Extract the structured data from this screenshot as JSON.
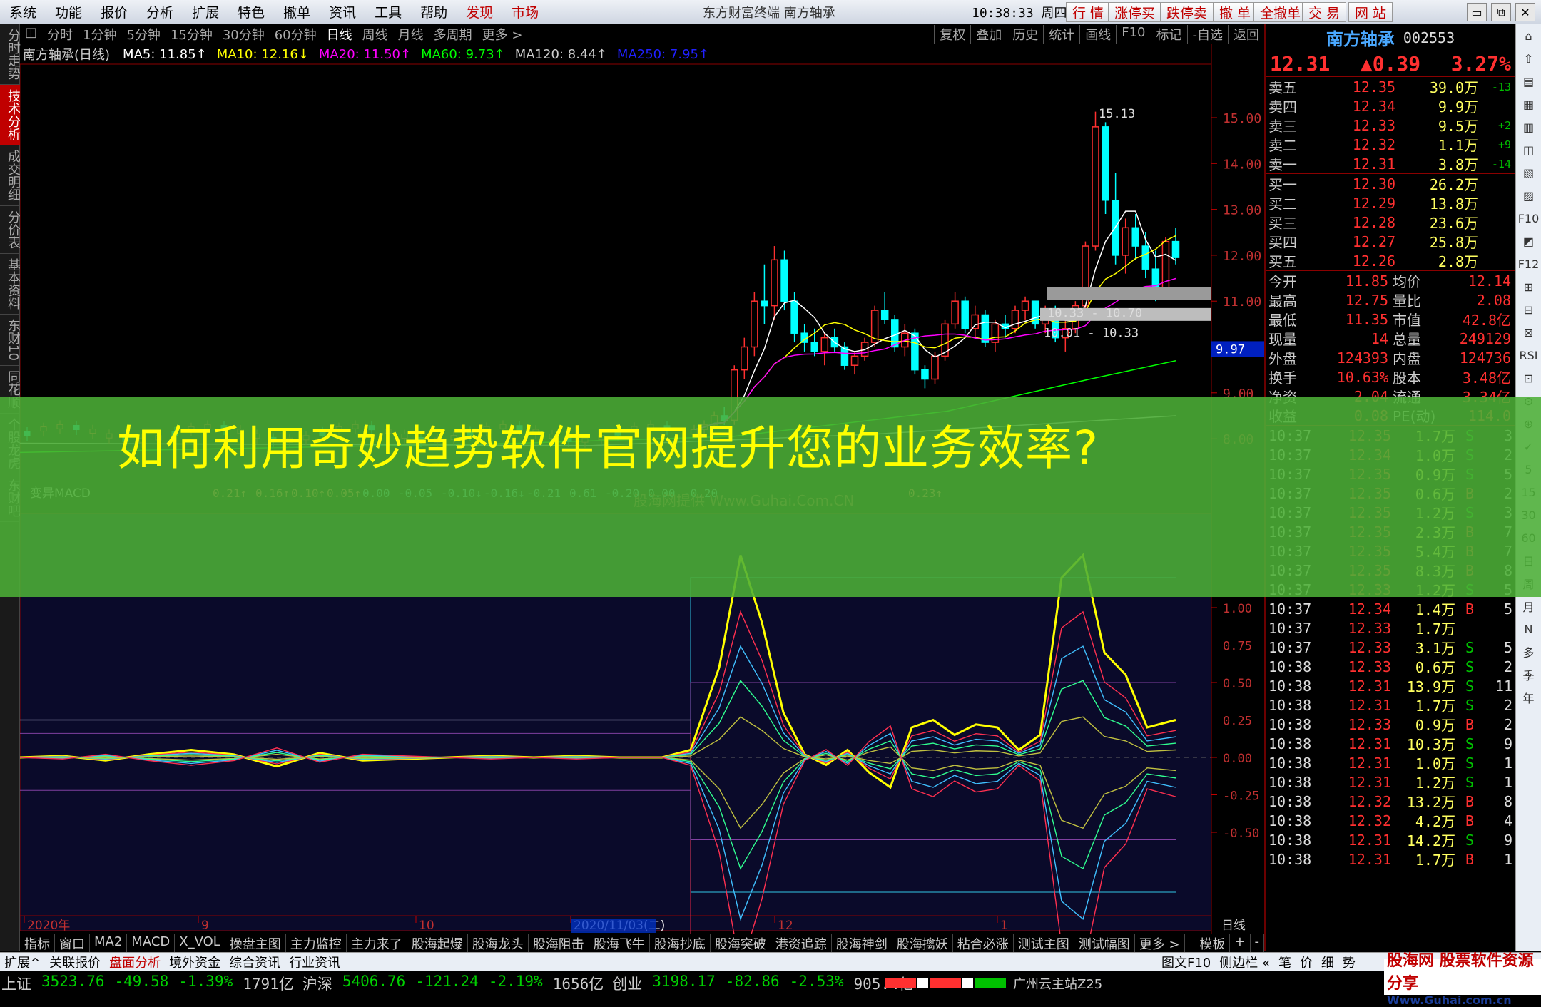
{
  "menubar": {
    "items": [
      "系统",
      "功能",
      "报价",
      "分析",
      "扩展",
      "特色",
      "撤单",
      "资讯",
      "工具",
      "帮助"
    ],
    "highlight_items": [
      "发现",
      "市场"
    ],
    "center_text": "东方财富终端  南方轴承",
    "clock": "10:38:33 周四",
    "right_buttons": [
      "行 情",
      "涨停买",
      "跌停卖",
      "撤 单",
      "全撤单",
      "交 易",
      "网 站"
    ],
    "window_buttons": [
      "▭",
      "⧉",
      "✕"
    ]
  },
  "left_tabs": [
    "分时走势",
    "技术分析",
    "成交明细",
    "分价表",
    "基本资料",
    "东财10",
    "同花顺",
    "个股龙虎",
    "东财吧"
  ],
  "toolbar": {
    "periods": [
      "分时",
      "1分钟",
      "5分钟",
      "15分钟",
      "30分钟",
      "60分钟",
      "日线",
      "周线",
      "月线",
      "多周期",
      "更多 >"
    ],
    "active_period": "日线",
    "right_tools": [
      "复权",
      "叠加",
      "历史",
      "统计",
      "画线",
      "F10",
      "标记",
      "-自选",
      "返回"
    ]
  },
  "infobar": {
    "title": "南方轴承(日线)",
    "ma": [
      {
        "label": "MA5: 11.85↑",
        "color": "#ffffff"
      },
      {
        "label": "MA10: 12.16↓",
        "color": "#ffff00"
      },
      {
        "label": "MA20: 11.50↑",
        "color": "#ff00ff"
      },
      {
        "label": "MA60: 9.73↑",
        "color": "#00ff00"
      },
      {
        "label": "MA120: 8.44↑",
        "color": "#cccccc"
      },
      {
        "label": "MA250: 7.95↑",
        "color": "#2020ff"
      }
    ]
  },
  "chart_data": [
    {
      "type": "candlestick",
      "title": "南方轴承(日线)",
      "y_ticks": [
        "15.00",
        "14.00",
        "13.00",
        "12.00",
        "11.00",
        "10.00",
        "9.00",
        "8.00"
      ],
      "price_tag": "9.97",
      "annotations": [
        "15.13",
        "10.33 - 10.70",
        "10.01 - 10.33"
      ],
      "x_labels": [
        "2020年",
        "9",
        "10",
        "2020/11/03(二)",
        "12",
        "1"
      ],
      "candles": [
        [
          8.1,
          8.3,
          8.0,
          8.2
        ],
        [
          8.2,
          8.4,
          8.1,
          8.3
        ],
        [
          8.3,
          8.6,
          8.2,
          8.5
        ],
        [
          8.5,
          8.7,
          8.3,
          8.4
        ],
        [
          8.4,
          9.6,
          8.3,
          9.5
        ],
        [
          9.5,
          10.2,
          9.3,
          10.0
        ],
        [
          10.0,
          11.2,
          9.8,
          11.0
        ],
        [
          11.0,
          11.8,
          10.5,
          10.9
        ],
        [
          10.9,
          12.2,
          10.6,
          11.9
        ],
        [
          11.9,
          12.1,
          10.8,
          11.0
        ],
        [
          11.0,
          11.2,
          10.1,
          10.3
        ],
        [
          10.3,
          10.5,
          9.9,
          10.1
        ],
        [
          10.1,
          10.4,
          9.8,
          9.9
        ],
        [
          9.9,
          10.3,
          9.6,
          10.2
        ],
        [
          10.2,
          10.4,
          9.9,
          10.0
        ],
        [
          10.0,
          10.1,
          9.5,
          9.6
        ],
        [
          9.6,
          9.9,
          9.4,
          9.8
        ],
        [
          9.8,
          10.2,
          9.7,
          10.1
        ],
        [
          10.1,
          10.9,
          10.0,
          10.8
        ],
        [
          10.8,
          11.2,
          10.5,
          10.6
        ],
        [
          10.6,
          10.7,
          9.9,
          10.0
        ],
        [
          10.0,
          10.5,
          9.8,
          10.3
        ],
        [
          10.3,
          10.4,
          9.4,
          9.5
        ],
        [
          9.5,
          9.6,
          9.1,
          9.3
        ],
        [
          9.3,
          9.9,
          9.2,
          9.8
        ],
        [
          9.8,
          10.6,
          9.7,
          10.5
        ],
        [
          10.5,
          11.2,
          10.4,
          11.0
        ],
        [
          11.0,
          11.1,
          10.3,
          10.4
        ],
        [
          10.4,
          10.9,
          10.2,
          10.7
        ],
        [
          10.7,
          10.8,
          10.0,
          10.1
        ],
        [
          10.1,
          10.6,
          9.9,
          10.5
        ],
        [
          10.5,
          10.7,
          10.2,
          10.4
        ],
        [
          10.4,
          10.9,
          10.3,
          10.8
        ],
        [
          10.8,
          11.1,
          10.6,
          11.0
        ],
        [
          11.0,
          11.0,
          10.4,
          10.5
        ],
        [
          10.5,
          10.9,
          10.3,
          10.8
        ],
        [
          10.8,
          10.9,
          10.1,
          10.2
        ],
        [
          10.2,
          10.6,
          9.9,
          10.4
        ],
        [
          10.4,
          11.0,
          10.3,
          10.9
        ],
        [
          10.9,
          12.3,
          10.8,
          12.2
        ],
        [
          12.2,
          15.13,
          12.1,
          14.8
        ],
        [
          14.8,
          14.9,
          12.9,
          13.2
        ],
        [
          13.2,
          13.8,
          11.8,
          12.0
        ],
        [
          12.0,
          12.8,
          11.6,
          12.6
        ],
        [
          12.6,
          12.9,
          11.9,
          12.2
        ],
        [
          12.2,
          12.5,
          11.5,
          11.7
        ],
        [
          11.7,
          12.1,
          11.0,
          11.3
        ],
        [
          11.3,
          12.4,
          11.1,
          12.3
        ],
        [
          12.3,
          12.6,
          11.8,
          11.95
        ]
      ]
    },
    {
      "type": "line",
      "title": "变异MACD",
      "values_text": [
        "0.21↑",
        "0.16↑",
        "0.10↑",
        "0.05↑",
        "0.00",
        "-0.05",
        "-0.10↓",
        "-0.16↓",
        "-0.21",
        "0.61",
        "-0.20",
        "0.00",
        "-0.20"
      ],
      "last_text": "0.23↑",
      "y_ticks": [
        "1.00",
        "0.75",
        "0.50",
        "0.25",
        "0.00",
        "-0.25",
        "-0.50"
      ],
      "watermark": "股海网提供 Www.Guhai.Com.CN"
    }
  ],
  "quote": {
    "name": "南方轴承",
    "code": "002553",
    "price": "12.31",
    "change": "▲0.39",
    "pct": "3.27%",
    "asks": [
      {
        "lbl": "卖五",
        "pr": "12.35",
        "vol": "39.0万",
        "chg": "-13"
      },
      {
        "lbl": "卖四",
        "pr": "12.34",
        "vol": "9.9万",
        "chg": ""
      },
      {
        "lbl": "卖三",
        "pr": "12.33",
        "vol": "9.5万",
        "chg": "+2"
      },
      {
        "lbl": "卖二",
        "pr": "12.32",
        "vol": "1.1万",
        "chg": "+9"
      },
      {
        "lbl": "卖一",
        "pr": "12.31",
        "vol": "3.8万",
        "chg": "-14"
      }
    ],
    "bids": [
      {
        "lbl": "买一",
        "pr": "12.30",
        "vol": "26.2万",
        "chg": ""
      },
      {
        "lbl": "买二",
        "pr": "12.29",
        "vol": "13.8万",
        "chg": ""
      },
      {
        "lbl": "买三",
        "pr": "12.28",
        "vol": "23.6万",
        "chg": ""
      },
      {
        "lbl": "买四",
        "pr": "12.27",
        "vol": "25.8万",
        "chg": ""
      },
      {
        "lbl": "买五",
        "pr": "12.26",
        "vol": "2.8万",
        "chg": ""
      }
    ],
    "stats": [
      [
        "今开",
        "11.85",
        "均价",
        "12.14"
      ],
      [
        "最高",
        "12.75",
        "量比",
        "2.08"
      ],
      [
        "最低",
        "11.35",
        "市值",
        "42.8亿"
      ],
      [
        "现量",
        "14",
        "总量",
        "249129"
      ],
      [
        "外盘",
        "124393",
        "内盘",
        "124736"
      ],
      [
        "换手",
        "10.63%",
        "股本",
        "3.48亿"
      ],
      [
        "净资",
        "2.04",
        "流通",
        "3.34亿"
      ],
      [
        "收益",
        "0.08",
        "PE(动)",
        "114.0"
      ]
    ],
    "trades": [
      [
        "10:37",
        "12.35",
        "1.7万",
        "S",
        "3"
      ],
      [
        "10:37",
        "12.34",
        "1.0万",
        "S",
        "2"
      ],
      [
        "10:37",
        "12.35",
        "0.9万",
        "S",
        "5"
      ],
      [
        "10:37",
        "12.35",
        "0.6万",
        "B",
        "2"
      ],
      [
        "10:37",
        "12.35",
        "1.2万",
        "S",
        "3"
      ],
      [
        "10:37",
        "12.35",
        "2.3万",
        "B",
        "7"
      ],
      [
        "10:37",
        "12.35",
        "5.4万",
        "B",
        "7"
      ],
      [
        "10:37",
        "12.35",
        "8.3万",
        "B",
        "8"
      ],
      [
        "10:37",
        "12.33",
        "1.2万",
        "S",
        "5"
      ],
      [
        "10:37",
        "12.34",
        "1.4万",
        "B",
        "5"
      ],
      [
        "10:37",
        "12.33",
        "1.7万",
        "",
        ""
      ],
      [
        "10:37",
        "12.33",
        "3.1万",
        "S",
        "5"
      ],
      [
        "10:38",
        "12.33",
        "0.6万",
        "S",
        "2"
      ],
      [
        "10:38",
        "12.31",
        "13.9万",
        "S",
        "11"
      ],
      [
        "10:38",
        "12.31",
        "1.7万",
        "S",
        "2"
      ],
      [
        "10:38",
        "12.33",
        "0.9万",
        "B",
        "2"
      ],
      [
        "10:38",
        "12.31",
        "10.3万",
        "S",
        "9"
      ],
      [
        "10:38",
        "12.31",
        "1.0万",
        "S",
        "1"
      ],
      [
        "10:38",
        "12.31",
        "1.2万",
        "S",
        "1"
      ],
      [
        "10:38",
        "12.32",
        "13.2万",
        "B",
        "8"
      ],
      [
        "10:38",
        "12.32",
        "4.2万",
        "B",
        "4"
      ],
      [
        "10:38",
        "12.31",
        "14.2万",
        "S",
        "9"
      ],
      [
        "10:38",
        "12.31",
        "1.7万",
        "B",
        "1"
      ]
    ]
  },
  "right_sidebar": [
    "⌂",
    "⇧",
    "▤",
    "▦",
    "▥",
    "◫",
    "▧",
    "▨",
    "F10",
    "◩",
    "F12",
    "⊞",
    "⊟",
    "⊠",
    "RSI",
    "⊡",
    "⊙",
    "⊕",
    "✓",
    "5",
    "15",
    "30",
    "60",
    "日",
    "周",
    "月",
    "N",
    "多",
    "季",
    "年"
  ],
  "bottom_tabs": [
    "指标",
    "窗口",
    "MA2",
    "MACD",
    "X_VOL",
    "操盘主图",
    "主力监控",
    "主力来了",
    "股海起爆",
    "股海龙头",
    "股海阻击",
    "股海飞牛",
    "股海抄底",
    "股海突破",
    "港资追踪",
    "股海神剑",
    "股海擒妖",
    "粘合必涨",
    "测试主图",
    "测试幅图",
    "更多 >"
  ],
  "bottom_right_tabs": [
    "模板",
    "+",
    "-"
  ],
  "statusbar": {
    "items": [
      "扩展^",
      "关联报价",
      "盘面分析",
      "境外资金",
      "综合资讯",
      "行业资讯"
    ],
    "selected": "盘面分析",
    "right_items": [
      "图文F10",
      "侧边栏 «",
      "笔",
      "价",
      "细",
      "势"
    ]
  },
  "indexbar": [
    {
      "name": "上证",
      "price": "3523.76",
      "chg": "-49.58",
      "pct": "-1.39%",
      "amt": "1791亿"
    },
    {
      "name": "沪深",
      "price": "5406.76",
      "chg": "-121.24",
      "pct": "-2.19%",
      "amt": "1656亿"
    },
    {
      "name": "创业",
      "price": "3198.17",
      "chg": "-82.86",
      "pct": "-2.53%",
      "amt": "905.4亿"
    }
  ],
  "indexbar_extra": "广州云主站Z25",
  "banner": {
    "title": "如何利用奇妙趋势软件官网提升您的业务效率?"
  },
  "logo": {
    "line1": "股海网 股票软件资源分享",
    "line2": "Www.Guhai.com.cn"
  },
  "colors": {
    "up": "#ff3030",
    "down": "#00ffff",
    "yellow": "#ffff00",
    "banner": "#4caf37"
  }
}
